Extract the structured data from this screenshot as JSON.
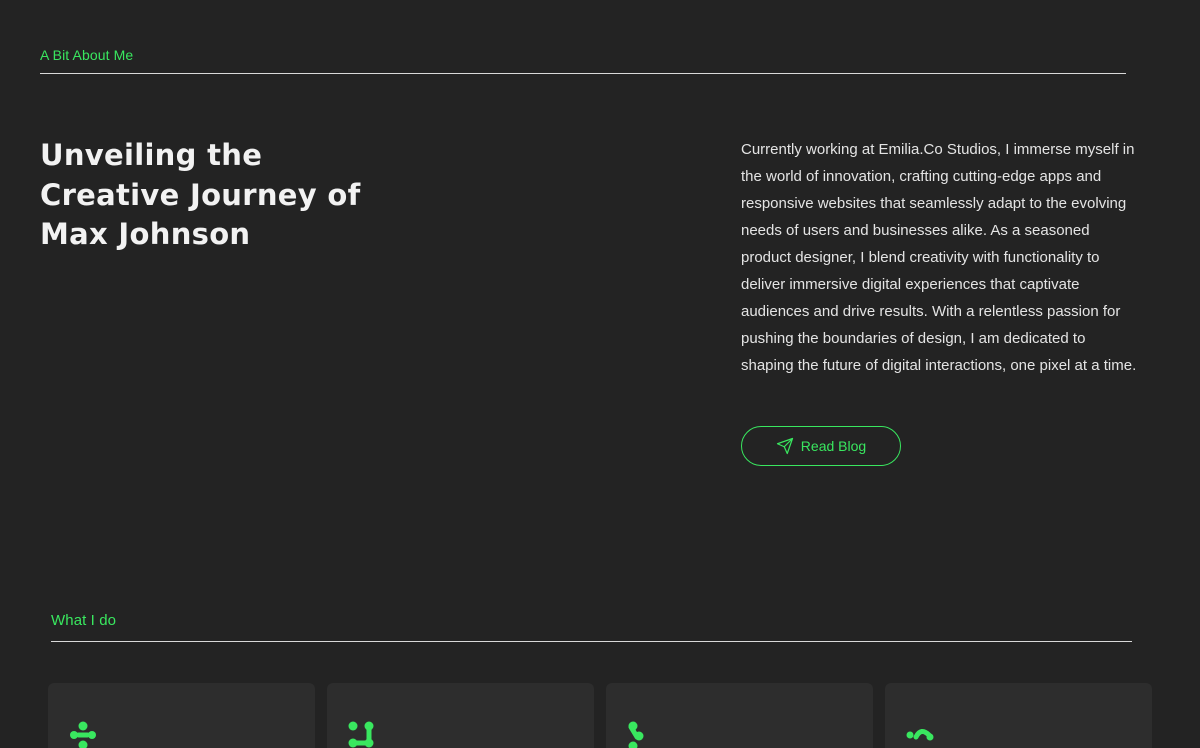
{
  "about": {
    "section_label": "A Bit About Me",
    "title": "Unveiling the Creative Journey of Max Johnson",
    "bio": "Currently working at Emilia.Co Studios, I immerse myself in the world of innovation, crafting cutting-edge apps and responsive websites that seamlessly adapt to the evolving needs of users and businesses alike. As a seasoned product designer, I blend creativity with functionality to deliver immersive digital experiences that captivate audiences and drive results. With a relentless passion for pushing the boundaries of design, I am dedicated to shaping the future of digital interactions, one pixel at a time.",
    "cta_label": "Read Blog",
    "cta_icon": "send-icon"
  },
  "services": {
    "section_label": "What I do",
    "cards": [
      {
        "icon": "molecule-cross-icon"
      },
      {
        "icon": "molecule-square-icon"
      },
      {
        "icon": "molecule-branch-icon"
      },
      {
        "icon": "molecule-arc-icon"
      }
    ]
  },
  "colors": {
    "background": "#232323",
    "card": "#2d2d2d",
    "accent": "#39e75f",
    "text": "#e8e8e8"
  }
}
